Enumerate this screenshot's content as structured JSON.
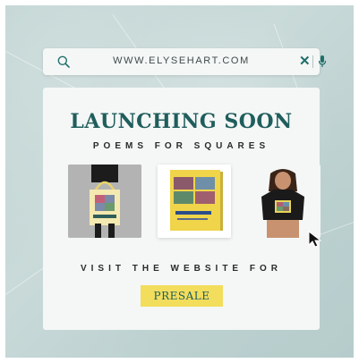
{
  "search": {
    "url": "WWW.ELYSEHART.COM",
    "search_icon": "search-icon",
    "close_icon": "close-icon",
    "mic_icon": "microphone-icon"
  },
  "card": {
    "title": "LAUNCHING SOON",
    "subtitle": "POEMS FOR SQUARES",
    "products": [
      {
        "name": "tote-bag-photo"
      },
      {
        "name": "book-photo",
        "book_title": "Poems for Squares"
      },
      {
        "name": "t-shirt-photo"
      }
    ],
    "visit_text": "VISIT THE WEBSITE FOR",
    "cta_label": "PRESALE"
  },
  "colors": {
    "accent_teal": "#1f5e5c",
    "button_yellow": "#f2dd5c",
    "background": "#c2d5d4"
  }
}
